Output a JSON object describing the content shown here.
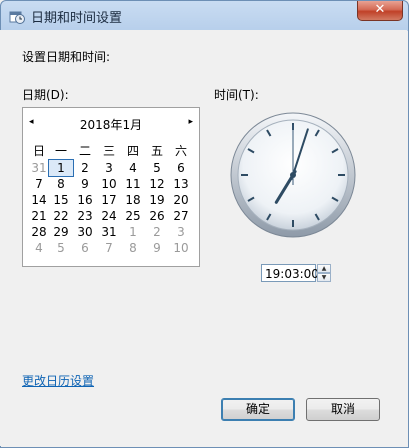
{
  "window": {
    "title": "日期和时间设置",
    "close_glyph": "✕"
  },
  "heading": "设置日期和时间:",
  "date_label": "日期(D):",
  "time_label": "时间(T):",
  "calendar": {
    "title": "2018年1月",
    "prev_glyph": "◂",
    "next_glyph": "▸",
    "weekdays": [
      "日",
      "一",
      "二",
      "三",
      "四",
      "五",
      "六"
    ],
    "weeks": [
      [
        "31",
        "1",
        "2",
        "3",
        "4",
        "5",
        "6"
      ],
      [
        "7",
        "8",
        "9",
        "10",
        "11",
        "12",
        "13"
      ],
      [
        "14",
        "15",
        "16",
        "17",
        "18",
        "19",
        "20"
      ],
      [
        "21",
        "22",
        "23",
        "24",
        "25",
        "26",
        "27"
      ],
      [
        "28",
        "29",
        "30",
        "31",
        "1",
        "2",
        "3"
      ],
      [
        "4",
        "5",
        "6",
        "7",
        "8",
        "9",
        "10"
      ]
    ],
    "selected_day": "1"
  },
  "clock": {
    "hour": 19,
    "minute": 3,
    "second": 0
  },
  "time_value": "19:03:00",
  "spinner": {
    "up_glyph": "▲",
    "down_glyph": "▼"
  },
  "change_calendar_link": "更改日历设置",
  "buttons": {
    "ok": "确定",
    "cancel": "取消"
  }
}
